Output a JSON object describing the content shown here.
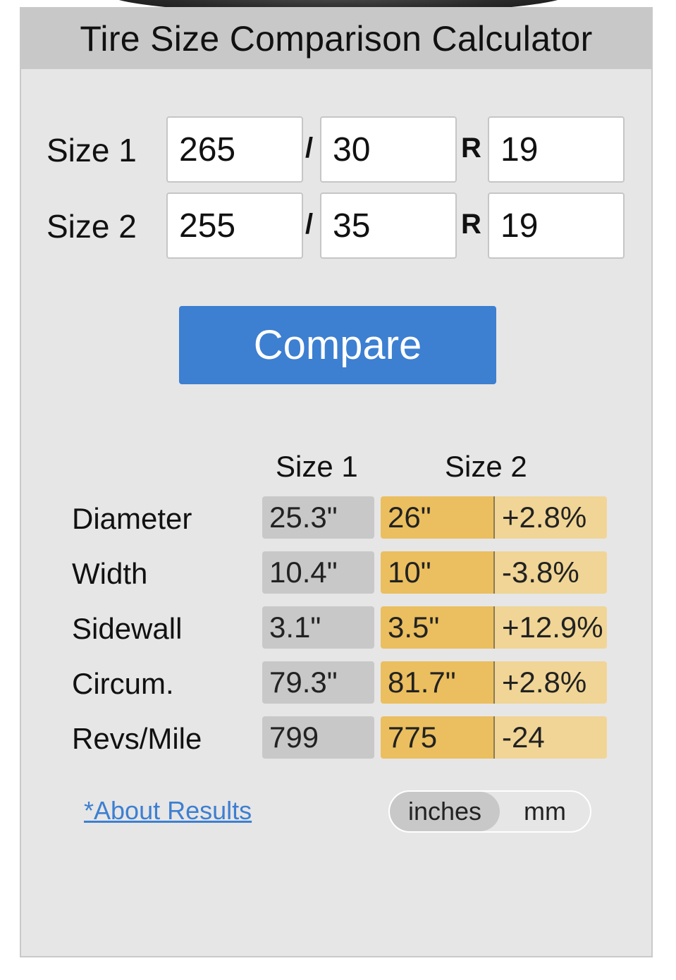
{
  "header": {
    "title": "Tire Size Comparison Calculator"
  },
  "inputs": {
    "size1": {
      "label": "Size 1",
      "width": "265",
      "aspect": "30",
      "rim": "19"
    },
    "size2": {
      "label": "Size 2",
      "width": "255",
      "aspect": "35",
      "rim": "19"
    },
    "slash": "/",
    "rim_marker": "R"
  },
  "compare_button": "Compare",
  "results": {
    "headers": {
      "size1": "Size 1",
      "size2": "Size 2"
    },
    "rows": [
      {
        "label": "Diameter",
        "size1": "25.3\"",
        "size2": "26\"",
        "diff": "+2.8%"
      },
      {
        "label": "Width",
        "size1": "10.4\"",
        "size2": "10\"",
        "diff": "-3.8%"
      },
      {
        "label": "Sidewall",
        "size1": "3.1\"",
        "size2": "3.5\"",
        "diff": "+12.9%"
      },
      {
        "label": "Circum.",
        "size1": "79.3\"",
        "size2": "81.7\"",
        "diff": "+2.8%"
      },
      {
        "label": "Revs/Mile",
        "size1": "799",
        "size2": "775",
        "diff": "-24"
      }
    ]
  },
  "about_link": "*About Results",
  "units_toggle": {
    "options": [
      "inches",
      "mm"
    ],
    "selected": "inches"
  },
  "colors": {
    "accent_blue": "#3d7fd1",
    "size2_cell": "#ebbf5f",
    "diff_cell": "#f0d596",
    "size1_cell": "#c8c8c8",
    "panel": "#e6e6e6"
  }
}
